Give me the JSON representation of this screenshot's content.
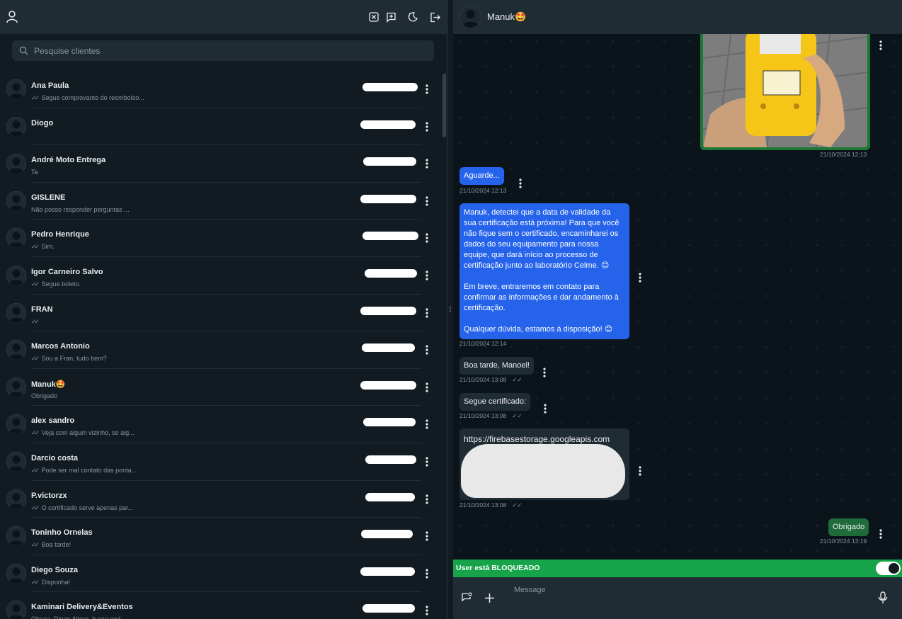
{
  "search": {
    "placeholder": "Pesquise clientes"
  },
  "header_icons": [
    "user-icon",
    "close-square-icon",
    "new-chat-icon",
    "theme-icon",
    "logout-icon"
  ],
  "chats": [
    {
      "name": "Ana Paula",
      "preview": "Segue comprovante do reembolso...",
      "ticks": true
    },
    {
      "name": "Diogo",
      "preview": "",
      "ticks": false
    },
    {
      "name": "André Moto Entrega",
      "preview": "Ta",
      "ticks": false
    },
    {
      "name": "GISLENE",
      "preview": "Não posso responder perguntas ...",
      "ticks": false
    },
    {
      "name": "Pedro Henrique",
      "preview": "Sim.",
      "ticks": true
    },
    {
      "name": "Igor Carneiro Salvo",
      "preview": "Segue boleto.",
      "ticks": true
    },
    {
      "name": "FRAN",
      "preview": "",
      "ticks": true
    },
    {
      "name": "Marcos Antonio",
      "preview": "Sou a Fran, tudo bem?",
      "ticks": true
    },
    {
      "name": "Manuk🤩",
      "preview": "Obrigado",
      "ticks": false
    },
    {
      "name": "alex sandro",
      "preview": "Veja com algum vizinho, se alg...",
      "ticks": true
    },
    {
      "name": "Darcio costa",
      "preview": "Pode ser mal contato das ponta...",
      "ticks": true
    },
    {
      "name": "P.victorzx",
      "preview": "O certificado serve apenas par...",
      "ticks": true
    },
    {
      "name": "Toninho Ornelas",
      "preview": "Boa tarde!",
      "ticks": true
    },
    {
      "name": "Diego Souza",
      "preview": "Disponha!",
      "ticks": true
    },
    {
      "name": "Kaminari Delivery&Eventos",
      "preview": "Obaaa, Diogo Altero. Ir seu ped...",
      "ticks": false
    }
  ],
  "conversation": {
    "contact_name": "Manuk🤩",
    "messages": {
      "image_stamp": "21/10/2024 12:13",
      "aguarde": "Aguarde...",
      "aguarde_stamp": "21/10/2024 12:13",
      "long_p1": "Manuk, detectei que a data de validade da sua certificação está próxima! Para que você não fique sem o certificado, encaminharei os dados do seu equipamento para nossa equipe, que dará início ao processo de certificação junto ao laboratório Celme. 😊",
      "long_p2": "Em breve, entraremos em contato para confirmar as informações e dar andamento à certificação.",
      "long_p3": "Qualquer dúvida, estamos à disposição! 😊",
      "long_stamp": "21/10/2024 12:14",
      "boa_tarde": "Boa tarde, Manoel!",
      "boa_tarde_stamp": "21/10/2024 13:08",
      "segue": "Segue certificado:",
      "segue_stamp": "21/10/2024 13:08",
      "link": "https://firebasestorage.googleapis.com",
      "link_stamp": "21/10/2024 13:08",
      "obrigado": "Obrigado",
      "obrigado_stamp": "21/10/2024 13:19"
    }
  },
  "blocked": {
    "label": "User está BLOQUEADO",
    "toggle_on": true
  },
  "composer": {
    "placeholder": "Message"
  },
  "colors": {
    "accent_blue": "#2563eb",
    "accent_green": "#16a34a",
    "panel": "#202c33",
    "background": "#111b21"
  }
}
